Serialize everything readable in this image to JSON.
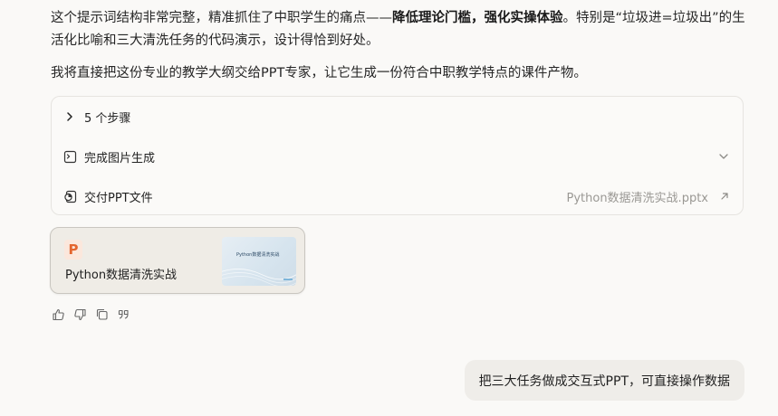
{
  "message": {
    "paragraph1_pre": "这个提示词结构非常完整，精准抓住了中职学生的痛点——",
    "paragraph1_bold": "降低理论门槛，强化实操体验",
    "paragraph1_post": "。特别是“垃圾进=垃圾出”的生活化比喻和三大清洗任务的代码演示，设计得恰到好处。",
    "paragraph2": "我将直接把这份专业的教学大纲交给PPT专家，让它生成一份符合中职教学特点的课件产物。"
  },
  "steps": {
    "toggle_label": "5 个步骤",
    "image_step_label": "完成图片生成",
    "deliver_step_label": "交付PPT文件",
    "deliver_filename": "Python数据清洗实战.pptx"
  },
  "file_card": {
    "badge": "P",
    "title": "Python数据清洗实战",
    "thumb_title": "Python数据清洗实战"
  },
  "actions": [
    {
      "icon": "thumbs-up-icon"
    },
    {
      "icon": "thumbs-down-icon"
    },
    {
      "icon": "copy-icon"
    },
    {
      "icon": "quote-icon"
    }
  ],
  "user_message": "把三大任务做成交互式PPT，可直接操作数据",
  "colors": {
    "background": "#faf9f7",
    "ppt_accent": "#e4652e",
    "muted_text": "#9a9894"
  }
}
